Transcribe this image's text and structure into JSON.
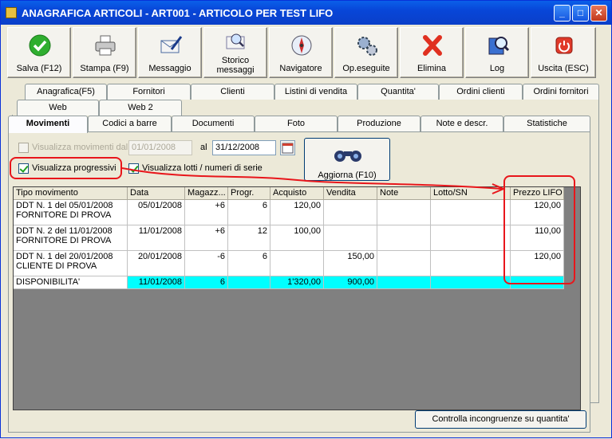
{
  "window": {
    "title": "ANAGRAFICA ARTICOLI - ART001 - ARTICOLO PER TEST LIFO",
    "minimize": "_",
    "maximize": "□",
    "close": "✕"
  },
  "toolbar": [
    {
      "label": "Salva (F12)",
      "icon": "check-icon"
    },
    {
      "label": "Stampa (F9)",
      "icon": "printer-icon"
    },
    {
      "label": "Messaggio",
      "icon": "envelope-pen-icon"
    },
    {
      "label": "Storico messaggi",
      "icon": "envelope-search-icon"
    },
    {
      "label": "Navigatore",
      "icon": "compass-icon"
    },
    {
      "label": "Op.eseguite",
      "icon": "gears-icon"
    },
    {
      "label": "Elimina",
      "icon": "red-x-icon"
    },
    {
      "label": "Log",
      "icon": "magnifier-book-icon"
    },
    {
      "label": "Uscita (ESC)",
      "icon": "power-icon"
    }
  ],
  "tabs_row1": [
    "Anagrafica(F5)",
    "Fornitori",
    "Clienti",
    "Listini di vendita",
    "Quantita'",
    "Ordini clienti",
    "Ordini fornitori"
  ],
  "tabs_row2": [
    "Web",
    "Web 2"
  ],
  "tabs_row3": [
    "Movimenti",
    "Codici a barre",
    "Documenti",
    "Foto",
    "Produzione",
    "Note e descr.",
    "Statistiche"
  ],
  "filters": {
    "visualizza_movimenti_dal": "Visualizza movimenti dal",
    "date_from": "01/01/2008",
    "al": "al",
    "date_to": "31/12/2008",
    "visualizza_progressivi": "Visualizza progressivi",
    "visualizza_lotti": "Visualizza lotti /  numeri di serie",
    "aggiorna": "Aggiorna (F10)"
  },
  "table": {
    "headers": [
      "Tipo movimento",
      "Data",
      "Magazz...",
      "Progr.",
      "Acquisto",
      "Vendita",
      "Note",
      "Lotto/SN",
      "Prezzo LIFO"
    ],
    "rows": [
      {
        "tipo1": "DDT N. 1 del 05/01/2008",
        "tipo2": "FORNITORE DI PROVA",
        "data": "05/01/2008",
        "magazz": "+6",
        "progr": "6",
        "acquisto": "120,00",
        "vendita": "",
        "note": "",
        "lotto": "",
        "lifo": "120,00"
      },
      {
        "tipo1": "DDT N. 2 del 11/01/2008",
        "tipo2": "FORNITORE DI PROVA",
        "data": "11/01/2008",
        "magazz": "+6",
        "progr": "12",
        "acquisto": "100,00",
        "vendita": "",
        "note": "",
        "lotto": "",
        "lifo": "110,00"
      },
      {
        "tipo1": "DDT N. 1 del 20/01/2008",
        "tipo2": "CLIENTE DI PROVA",
        "data": "20/01/2008",
        "magazz": "-6",
        "progr": "6",
        "acquisto": "",
        "vendita": "150,00",
        "note": "",
        "lotto": "",
        "lifo": "120,00"
      }
    ],
    "total": {
      "label": "DISPONIBILITA'",
      "data": "11/01/2008",
      "magazz": "6",
      "progr": "",
      "acquisto": "1'320,00",
      "vendita": "900,00",
      "note": "",
      "lotto": "",
      "lifo": ""
    }
  },
  "footer_button": "Controlla incongruenze su quantita'",
  "colors": {
    "annotation": "#e8161b",
    "total_row": "#00ffff"
  }
}
